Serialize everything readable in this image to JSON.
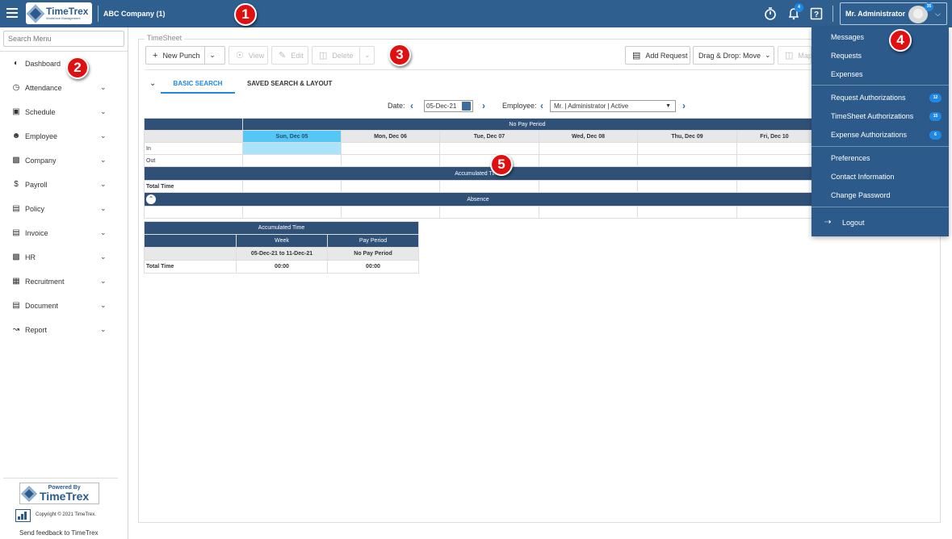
{
  "header": {
    "brand": "TimeTrex",
    "brand_tagline": "Workforce Management",
    "company": "ABC Company (1)",
    "notification_count": "4",
    "user_name": "Mr. Administrator",
    "user_badge": "35"
  },
  "callouts": [
    "1",
    "2",
    "3",
    "4",
    "5"
  ],
  "sidebar": {
    "search_placeholder": "Search Menu",
    "items": [
      {
        "label": "Dashboard",
        "icon": "speedometer-icon"
      },
      {
        "label": "Attendance",
        "icon": "clock-icon"
      },
      {
        "label": "Schedule",
        "icon": "calendar-icon"
      },
      {
        "label": "Employee",
        "icon": "people-icon"
      },
      {
        "label": "Company",
        "icon": "building-icon"
      },
      {
        "label": "Payroll",
        "icon": "dollar-icon"
      },
      {
        "label": "Policy",
        "icon": "policy-icon"
      },
      {
        "label": "Invoice",
        "icon": "invoice-icon"
      },
      {
        "label": "HR",
        "icon": "briefcase-icon"
      },
      {
        "label": "Recruitment",
        "icon": "recruitment-icon"
      },
      {
        "label": "Document",
        "icon": "document-icon"
      },
      {
        "label": "Report",
        "icon": "chart-line-icon"
      }
    ],
    "powered_by": "Powered By",
    "footer_brand": "TimeTrex",
    "copyright": "Copyright © 2021 TimeTrex.",
    "feedback": "Send feedback to TimeTrex"
  },
  "main": {
    "title": "TimeSheet",
    "toolbar": {
      "new_punch": "New Punch",
      "view": "View",
      "edit": "Edit",
      "delete": "Delete",
      "add_request": "Add Request",
      "drag_drop": "Drag & Drop: Move",
      "map": "Map"
    },
    "tabs": [
      "BASIC SEARCH",
      "SAVED SEARCH & LAYOUT"
    ],
    "filters": {
      "date_label": "Date:",
      "date_value": "05-Dec-21",
      "employee_label": "Employee:",
      "employee_value": "Mr. | Administrator | Active"
    },
    "grid": {
      "pay_period": "No Pay Period",
      "days": [
        "Sun, Dec 05",
        "Mon, Dec 06",
        "Tue, Dec 07",
        "Wed, Dec 08",
        "Thu, Dec 09",
        "Fri, Dec 10"
      ],
      "row_in": "In",
      "row_out": "Out",
      "accumulated": "Accumulated Time",
      "total_time": "Total Time",
      "absence": "Absence"
    },
    "summary": {
      "title": "Accumulated Time",
      "col_week": "Week",
      "col_pay_period": "Pay Period",
      "week_range": "05-Dec-21 to 11-Dec-21",
      "pay_period_value": "No Pay Period",
      "row_label": "Total Time",
      "week_total": "00:00",
      "pay_period_total": "00:00"
    }
  },
  "user_menu": {
    "messages": "Messages",
    "requests": "Requests",
    "expenses": "Expenses",
    "request_auth": "Request Authorizations",
    "request_auth_count": "12",
    "timesheet_auth": "TimeSheet Authorizations",
    "timesheet_auth_count": "15",
    "expense_auth": "Expense Authorizations",
    "expense_auth_count": "6",
    "preferences": "Preferences",
    "contact": "Contact Information",
    "change_password": "Change Password",
    "logout": "Logout"
  },
  "colors": {
    "header_bg": "#2f5f8f",
    "accent": "#1e88e5",
    "callout": "#e01010",
    "grid_header": "#2f5178",
    "selected_day": "#54c7f4"
  }
}
